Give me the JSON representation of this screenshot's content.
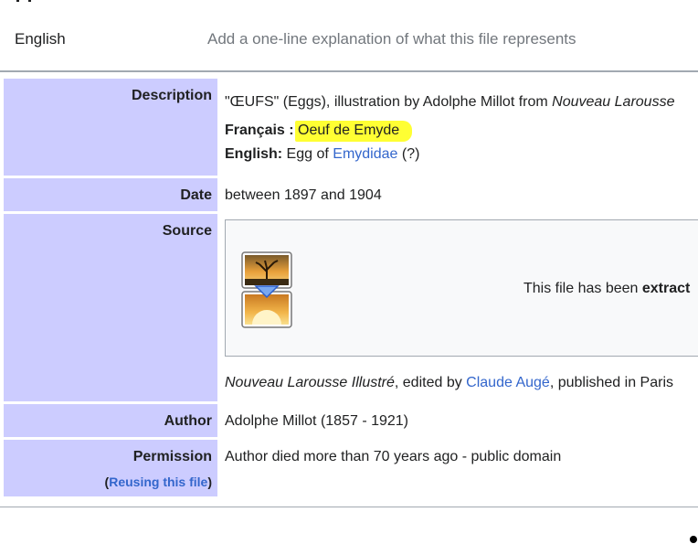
{
  "caption": {
    "language": "English",
    "placeholder": "Add a one-line explanation of what this file represents"
  },
  "rows": {
    "description": {
      "label": "Description",
      "line1_quote": "\"ŒUFS\" (Eggs), illustration by Adolphe Millot from ",
      "line1_italic": "Nouveau Larousse",
      "fr_label": "Français",
      "fr_sep": " : ",
      "fr_value": "Oeuf de Emyde",
      "en_label": "English:",
      "en_pre": " Egg of ",
      "en_link": "Emydidae",
      "en_post": " (?)"
    },
    "date": {
      "label": "Date",
      "value": "between 1897 and 1904"
    },
    "source": {
      "label": "Source",
      "extract_text_pre": "This file has been ",
      "extract_text_bold": "extract",
      "pub_italic": "Nouveau Larousse Illustré",
      "pub_mid": ", edited by ",
      "pub_link": "Claude Augé",
      "pub_post": ", published in Paris"
    },
    "author": {
      "label": "Author",
      "value": "Adolphe Millot (1857 - 1921)"
    },
    "permission": {
      "label": "Permission",
      "reuse_open": "(",
      "reuse_link": "Reusing this file",
      "reuse_close": ")",
      "value": "Author died more than 70 years ago - public domain"
    }
  },
  "colors": {
    "label_bg": "#ccccff",
    "link": "#3366cc",
    "highlight": "#ffff33"
  },
  "icons": {
    "extract": "extracted-image-icon"
  }
}
